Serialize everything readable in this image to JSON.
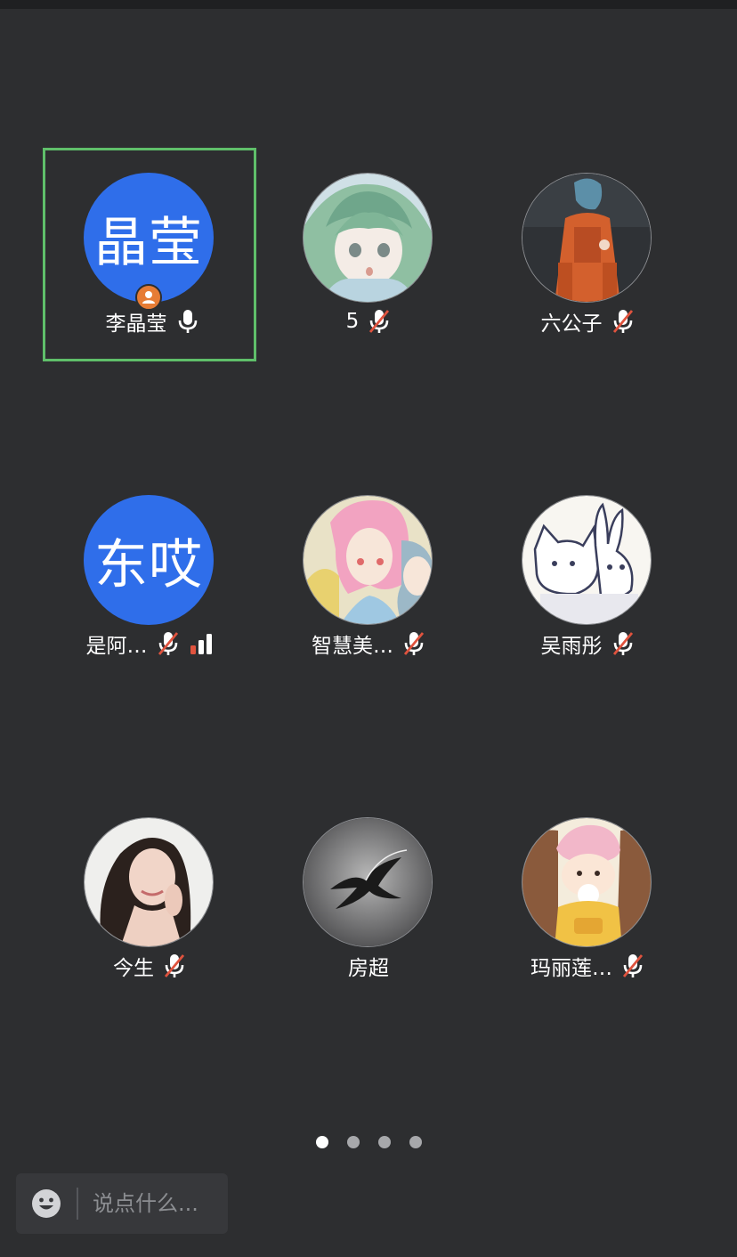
{
  "participants": [
    {
      "id": "p1",
      "name": "李晶莹",
      "avatar_text": "晶莹",
      "avatar_kind": "text",
      "mic": "on",
      "host": true,
      "speaking": true
    },
    {
      "id": "p2",
      "name": "5",
      "avatar_kind": "image",
      "avatar_icon": "anime-girl-avatar",
      "mic": "muted"
    },
    {
      "id": "p3",
      "name": "六公子",
      "avatar_kind": "image",
      "avatar_icon": "astronaut-avatar",
      "mic": "muted"
    },
    {
      "id": "p4",
      "name": "是阿…",
      "avatar_text": "东哎",
      "avatar_kind": "text",
      "mic": "muted",
      "signal": "weak"
    },
    {
      "id": "p5",
      "name": "智慧美…",
      "avatar_kind": "image",
      "avatar_icon": "cartoon-women-avatar",
      "mic": "muted"
    },
    {
      "id": "p6",
      "name": "吴雨彤",
      "avatar_kind": "image",
      "avatar_icon": "cat-rabbit-avatar",
      "mic": "muted"
    },
    {
      "id": "p7",
      "name": "今生",
      "avatar_kind": "image",
      "avatar_icon": "woman-photo-avatar",
      "mic": "muted"
    },
    {
      "id": "p8",
      "name": "房超",
      "avatar_kind": "image",
      "avatar_icon": "bird-avatar",
      "mic": "none"
    },
    {
      "id": "p9",
      "name": "玛丽莲…",
      "avatar_kind": "image",
      "avatar_icon": "cartoon-bear-avatar",
      "mic": "muted"
    }
  ],
  "pager": {
    "total": 4,
    "active_index": 0
  },
  "chat": {
    "placeholder": "说点什么...",
    "emoji_icon": "smiley-icon"
  },
  "colors": {
    "background": "#2d2e30",
    "avatar_blue": "#2f6eea",
    "speaking_border": "#5fbf6a",
    "host_badge": "#e67c35",
    "muted_slash": "#e0533e"
  }
}
